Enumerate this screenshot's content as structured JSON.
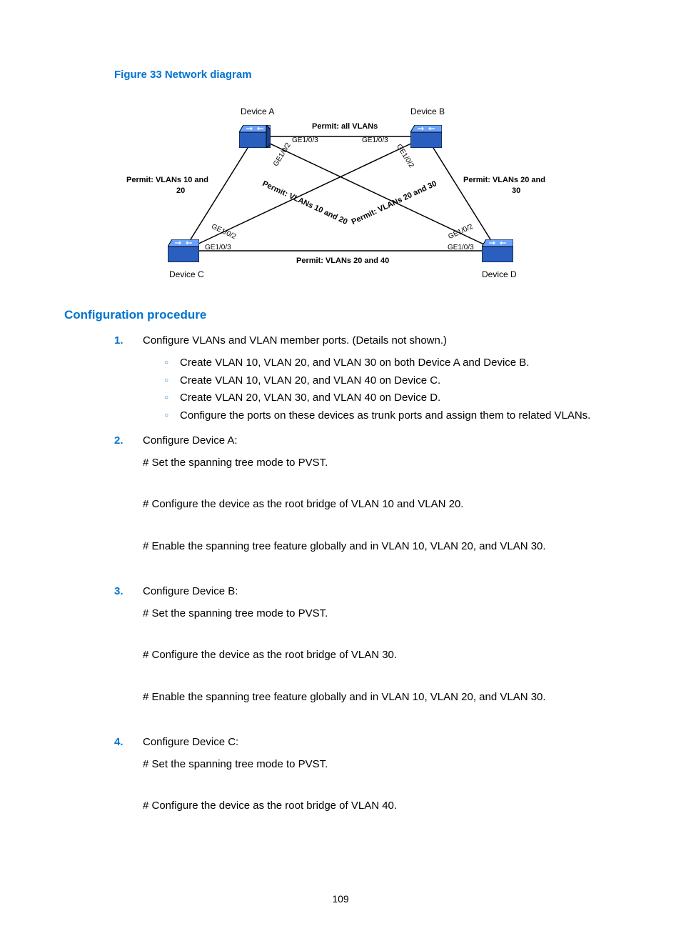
{
  "figure": {
    "title": "Figure 33 Network diagram"
  },
  "devices": {
    "a": "Device A",
    "b": "Device B",
    "c": "Device C",
    "d": "Device D"
  },
  "edges": {
    "top": "Permit: all VLANs",
    "left": "Permit: VLANs 10 and",
    "left2": "20",
    "right": "Permit: VLANs 20 and",
    "right2": "30",
    "diagL": "Permit: VLANs 10 and 20",
    "diagR": "Permit: VLANs 20 and 30",
    "bottom": "Permit: VLANs 20 and  40"
  },
  "ports": {
    "a_top": "GE1/0/3",
    "b_top": "GE1/0/3",
    "a_side": "GE1/0/2",
    "b_side": "GE1/0/2",
    "c_top": "GE1/0/2",
    "d_top": "GE1/0/2",
    "c_bot": "GE1/0/3",
    "d_bot": "GE1/0/3"
  },
  "section": "Configuration procedure",
  "steps": {
    "s1": {
      "num": "1.",
      "text": "Configure VLANs and VLAN member ports. (Details not shown.)",
      "sub": [
        "Create VLAN 10, VLAN 20, and VLAN 30 on both Device A and Device B.",
        "Create VLAN 10, VLAN 20, and VLAN 40 on Device C.",
        "Create VLAN 20, VLAN 30, and VLAN 40 on Device D.",
        "Configure the ports on these devices as trunk ports and assign them to related VLANs."
      ]
    },
    "s2": {
      "num": "2.",
      "text": "Configure Device A:",
      "lines": [
        "# Set the spanning tree mode to PVST.",
        "# Configure the device as the root bridge of VLAN 10 and VLAN 20.",
        "# Enable the spanning tree feature globally and in VLAN 10, VLAN 20, and VLAN 30."
      ]
    },
    "s3": {
      "num": "3.",
      "text": "Configure Device B:",
      "lines": [
        "# Set the spanning tree mode to PVST.",
        "# Configure the device as the root bridge of VLAN 30.",
        "# Enable the spanning tree feature globally and in VLAN 10, VLAN 20, and VLAN 30."
      ]
    },
    "s4": {
      "num": "4.",
      "text": "Configure Device C:",
      "lines": [
        "# Set the spanning tree mode to PVST.",
        "# Configure the device as the root bridge of VLAN 40."
      ]
    }
  },
  "pagenum": "109"
}
